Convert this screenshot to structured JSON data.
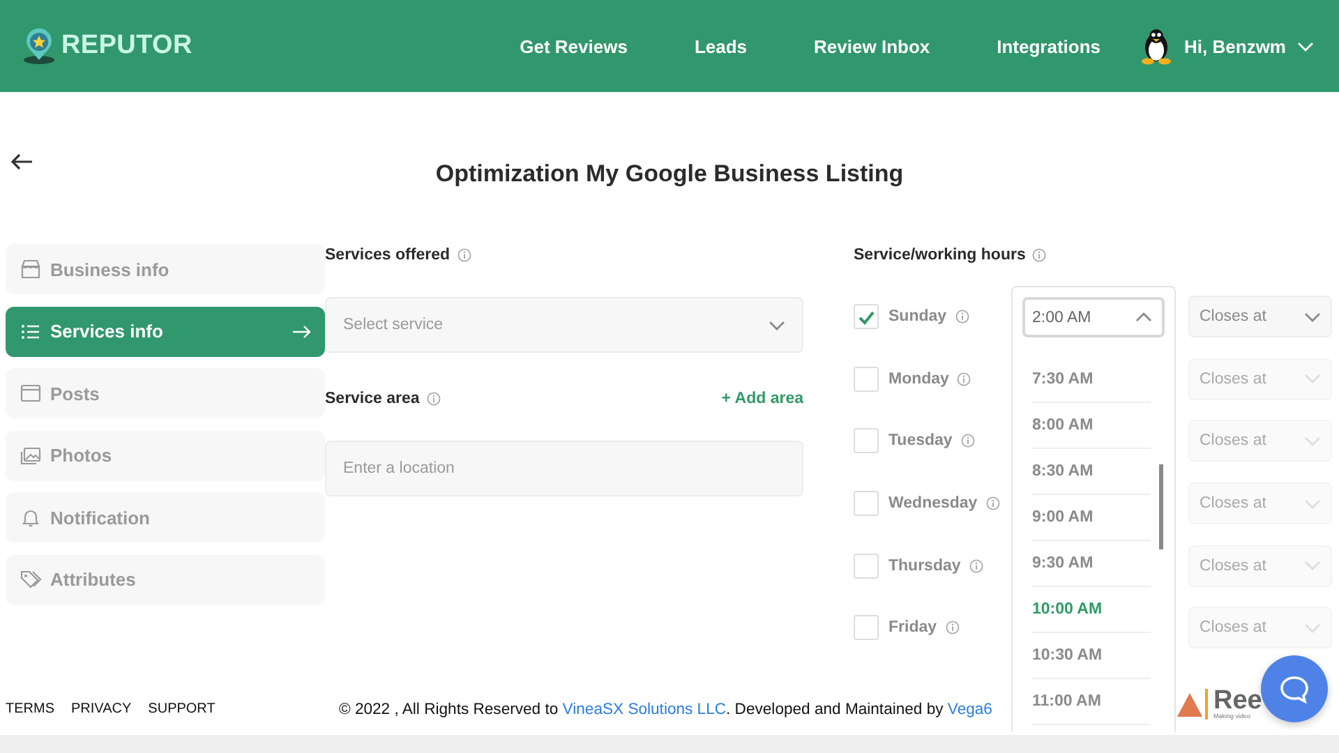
{
  "header": {
    "logo_text": "REPUTOR",
    "nav": [
      {
        "label": "Get Reviews"
      },
      {
        "label": "Leads"
      },
      {
        "label": "Review Inbox"
      },
      {
        "label": "Integrations"
      }
    ],
    "user": {
      "greeting": "Hi, Benzwm"
    }
  },
  "page": {
    "title": "Optimization My Google Business Listing"
  },
  "sidebar": {
    "items": [
      {
        "label": "Business info",
        "selected": false
      },
      {
        "label": "Services info",
        "selected": true
      },
      {
        "label": "Posts",
        "selected": false
      },
      {
        "label": "Photos",
        "selected": false
      },
      {
        "label": "Notification",
        "selected": false
      },
      {
        "label": "Attributes",
        "selected": false
      }
    ]
  },
  "services": {
    "offered": {
      "label": "Services offered",
      "placeholder": "Select service"
    },
    "area": {
      "label": "Service area",
      "add_link": "+ Add area",
      "placeholder": "Enter a location"
    }
  },
  "hours": {
    "label": "Service/working hours",
    "days": [
      {
        "name": "Sunday",
        "checked": true,
        "closes_placeholder": "Closes at"
      },
      {
        "name": "Monday",
        "checked": false,
        "closes_placeholder": "Closes at"
      },
      {
        "name": "Tuesday",
        "checked": false,
        "closes_placeholder": "Closes at"
      },
      {
        "name": "Wednesday",
        "checked": false,
        "closes_placeholder": "Closes at"
      },
      {
        "name": "Thursday",
        "checked": false,
        "closes_placeholder": "Closes at"
      },
      {
        "name": "Friday",
        "checked": false,
        "closes_placeholder": "Closes at"
      }
    ],
    "opening": {
      "value": "2:00 AM",
      "expanded": true,
      "options": [
        {
          "label": "7:30 AM",
          "selected": false
        },
        {
          "label": "8:00 AM",
          "selected": false
        },
        {
          "label": "8:30 AM",
          "selected": false
        },
        {
          "label": "9:00 AM",
          "selected": false
        },
        {
          "label": "9:30 AM",
          "selected": false
        },
        {
          "label": "10:00 AM",
          "selected": true
        },
        {
          "label": "10:30 AM",
          "selected": false
        },
        {
          "label": "11:00 AM",
          "selected": false
        }
      ]
    }
  },
  "footer": {
    "links": [
      "TERMS",
      "PRIVACY",
      "SUPPORT"
    ],
    "copyright": {
      "before": "© 2022 , All Rights Reserved to ",
      "company": "VineaSX Solutions LLC",
      "middle": ". Developed and Maintained by ",
      "developer": "Vega6"
    },
    "partner_logo": {
      "text": "Ree",
      "tagline": "Making video"
    }
  }
}
